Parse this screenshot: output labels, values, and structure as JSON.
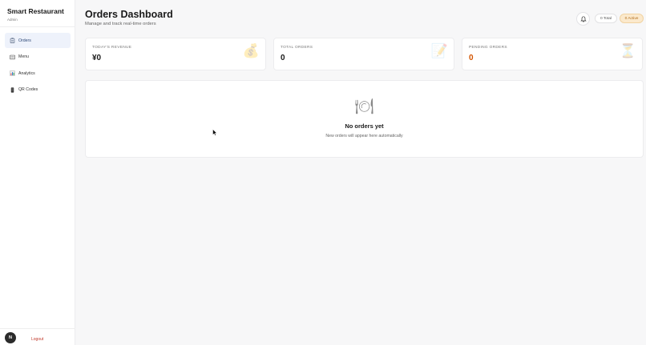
{
  "sidebar": {
    "brand_name": "Smart Restaurant",
    "brand_role": "Admin",
    "items": [
      {
        "label": "Orders",
        "icon": "clipboard-icon",
        "active": true
      },
      {
        "label": "Menu",
        "icon": "menu-icon",
        "active": false
      },
      {
        "label": "Analytics",
        "icon": "chart-icon",
        "active": false
      },
      {
        "label": "QR Codes",
        "icon": "phone-icon",
        "active": false
      }
    ],
    "avatar_letter": "N",
    "logout_label": "Logout"
  },
  "header": {
    "title": "Orders Dashboard",
    "subtitle": "Manage and track real-time orders",
    "total_pill": "0 Total",
    "active_pill": "0 Active"
  },
  "stats": [
    {
      "label": "TODAY'S REVENUE",
      "value": "¥0",
      "icon": "money-bag-icon"
    },
    {
      "label": "TOTAL ORDERS",
      "value": "0",
      "icon": "memo-icon"
    },
    {
      "label": "PENDING ORDERS",
      "value": "0",
      "icon": "hourglass-icon"
    }
  ],
  "empty_state": {
    "icon": "plate-cutlery-icon",
    "title": "No orders yet",
    "subtitle": "New orders will appear here automatically"
  },
  "colors": {
    "active_nav_bg": "#eef2fb",
    "pending_value": "#d35400",
    "active_pill_bg": "#fbe9cc",
    "logout": "#c0392b"
  }
}
